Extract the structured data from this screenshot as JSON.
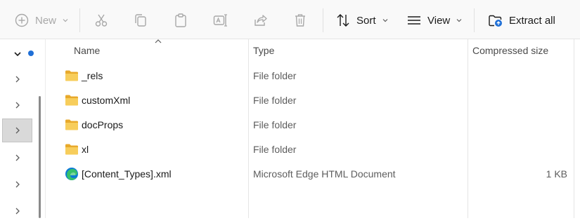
{
  "toolbar": {
    "new_label": "New",
    "sort_label": "Sort",
    "view_label": "View",
    "extract_label": "Extract all"
  },
  "columns": {
    "name": "Name",
    "type": "Type",
    "compressed_size": "Compressed size"
  },
  "files": [
    {
      "name": "_rels",
      "type": "File folder",
      "size": "",
      "icon": "folder-icon"
    },
    {
      "name": "customXml",
      "type": "File folder",
      "size": "",
      "icon": "folder-icon"
    },
    {
      "name": "docProps",
      "type": "File folder",
      "size": "",
      "icon": "folder-icon"
    },
    {
      "name": "xl",
      "type": "File folder",
      "size": "",
      "icon": "folder-icon"
    },
    {
      "name": "[Content_Types].xml",
      "type": "Microsoft Edge HTML Document",
      "size": "1 KB",
      "icon": "edge-icon"
    }
  ],
  "colors": {
    "folder": "#f3c453",
    "accent": "#1f6fd6"
  }
}
